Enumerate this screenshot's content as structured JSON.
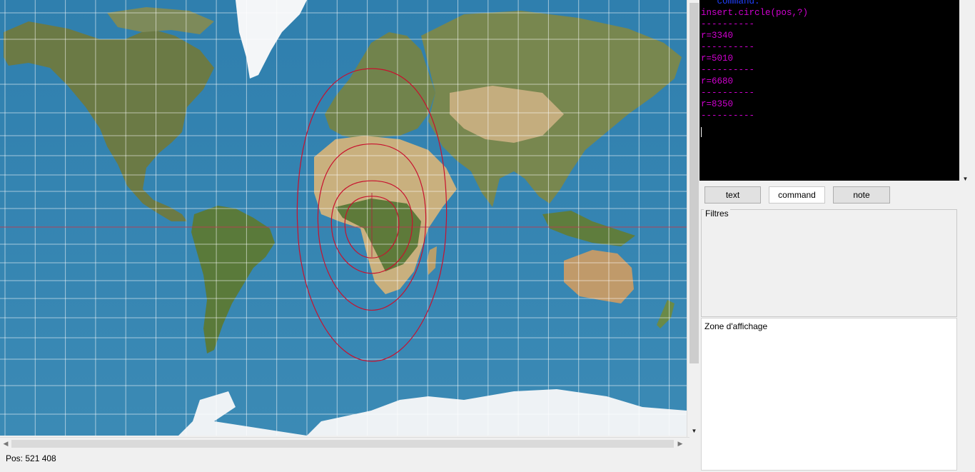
{
  "colors": {
    "ocean": "#3a86b0",
    "circle_stroke": "#c8102e",
    "graticule": "#ffffff",
    "console_bg": "#000000",
    "console_header": "#2040ff",
    "console_text": "#d000d0"
  },
  "map": {
    "circles_km": [
      3340,
      5010,
      6680,
      8350
    ],
    "reticle": "crosshair"
  },
  "console": {
    "lines": [
      {
        "text": "   command:",
        "style": "c-blue"
      },
      {
        "text": "insert.circle(pos,?)",
        "style": "c-mag"
      },
      {
        "text": "----------",
        "style": "c-mag"
      },
      {
        "text": "r=3340",
        "style": "c-mag"
      },
      {
        "text": "----------",
        "style": "c-mag"
      },
      {
        "text": "r=5010",
        "style": "c-mag"
      },
      {
        "text": "----------",
        "style": "c-mag"
      },
      {
        "text": "r=6680",
        "style": "c-mag"
      },
      {
        "text": "----------",
        "style": "c-mag"
      },
      {
        "text": "r=8350",
        "style": "c-mag"
      },
      {
        "text": "----------",
        "style": "c-mag"
      }
    ]
  },
  "tabs": [
    {
      "id": "text",
      "label": "text",
      "active": false
    },
    {
      "id": "command",
      "label": "command",
      "active": true
    },
    {
      "id": "note",
      "label": "note",
      "active": false
    }
  ],
  "filters": {
    "label": "Filtres"
  },
  "display_zone": {
    "label": "Zone d'affichage"
  },
  "status": {
    "position_text": "Pos: 521 408"
  }
}
